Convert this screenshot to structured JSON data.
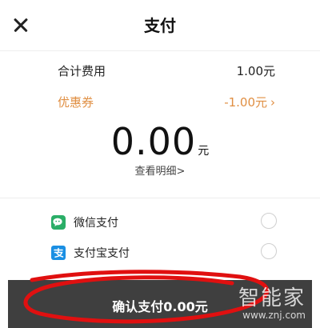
{
  "header": {
    "title": "支付"
  },
  "summary": {
    "fee_label": "合计费用",
    "fee_value": "1.00元",
    "coupon_label": "优惠券",
    "coupon_value": "-1.00元"
  },
  "total": {
    "amount": "0.00",
    "unit": "元",
    "detail_link": "查看明细>"
  },
  "payment_methods": [
    {
      "label": "微信支付",
      "icon": "wechat-pay-icon",
      "selected": false
    },
    {
      "label": "支付宝支付",
      "icon": "alipay-icon",
      "selected": false
    }
  ],
  "confirm": {
    "label": "确认支付0.00元"
  },
  "watermark": {
    "name": "智能家",
    "url": "www.znj.com"
  },
  "colors": {
    "coupon": "#e08f43",
    "wechat": "#2aae67",
    "alipay": "#1a8fe3",
    "annotation": "#e01010",
    "bar": "#3f3f3f"
  }
}
